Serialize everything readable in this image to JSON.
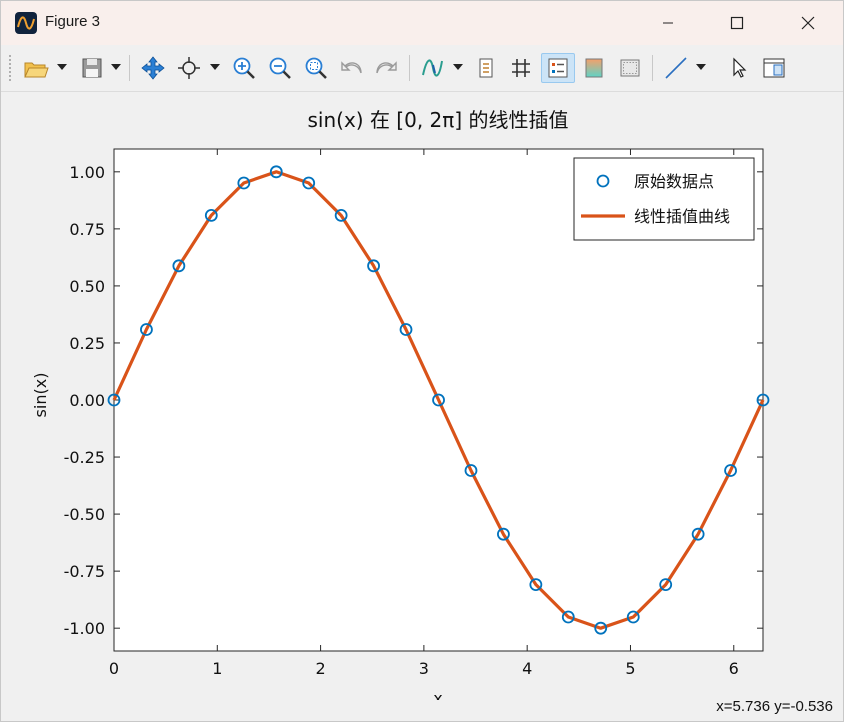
{
  "window": {
    "title": "Figure 3"
  },
  "toolbar": {
    "items": [
      "open-icon",
      "save-icon",
      "pan-icon",
      "data-cursor-icon",
      "zoom-in-icon",
      "zoom-out-icon",
      "zoom-fit-icon",
      "undo-icon",
      "redo-icon",
      "insert-legend-icon",
      "colorbar-icon",
      "grid-icon",
      "legend-toggle-icon",
      "colormap-icon",
      "border-icon",
      "line-style-icon",
      "select-icon",
      "property-inspector-icon"
    ]
  },
  "status": {
    "coords": "x=5.736 y=-0.536"
  },
  "colors": {
    "series_line": "#d95319",
    "markers": "#0072bd"
  },
  "chart_data": {
    "type": "line",
    "title": "sin(x) 在 [0, 2π] 的线性插值",
    "xlabel": "x",
    "ylabel": "sin(x)",
    "xlim": [
      0,
      6.283
    ],
    "ylim": [
      -1.1,
      1.1
    ],
    "xticks": [
      0,
      1,
      2,
      3,
      4,
      5,
      6
    ],
    "xtick_labels": [
      "0",
      "1",
      "2",
      "3",
      "4",
      "5",
      "6"
    ],
    "yticks": [
      -1.0,
      -0.75,
      -0.5,
      -0.25,
      0.0,
      0.25,
      0.5,
      0.75,
      1.0
    ],
    "ytick_labels": [
      "-1.00",
      "-0.75",
      "-0.50",
      "-0.25",
      "0.00",
      "0.25",
      "0.50",
      "0.75",
      "1.00"
    ],
    "legend_position": "top-right",
    "grid": false,
    "series": [
      {
        "name": "原始数据点",
        "kind": "scatter",
        "marker": "circle-open",
        "x": [
          0,
          0.314,
          0.628,
          0.942,
          1.257,
          1.571,
          1.885,
          2.199,
          2.513,
          2.827,
          3.142,
          3.456,
          3.77,
          4.084,
          4.398,
          4.712,
          5.027,
          5.341,
          5.655,
          5.969,
          6.283
        ],
        "y": [
          0,
          0.309,
          0.588,
          0.809,
          0.951,
          1.0,
          0.951,
          0.809,
          0.588,
          0.309,
          0,
          -0.309,
          -0.588,
          -0.809,
          -0.951,
          -1.0,
          -0.951,
          -0.809,
          -0.588,
          -0.309,
          0
        ]
      },
      {
        "name": "线性插值曲线",
        "kind": "line",
        "x": [
          0,
          0.314,
          0.628,
          0.942,
          1.257,
          1.571,
          1.885,
          2.199,
          2.513,
          2.827,
          3.142,
          3.456,
          3.77,
          4.084,
          4.398,
          4.712,
          5.027,
          5.341,
          5.655,
          5.969,
          6.283
        ],
        "y": [
          0,
          0.309,
          0.588,
          0.809,
          0.951,
          1.0,
          0.951,
          0.809,
          0.588,
          0.309,
          0,
          -0.309,
          -0.588,
          -0.809,
          -0.951,
          -1.0,
          -0.951,
          -0.809,
          -0.588,
          -0.309,
          0
        ]
      }
    ]
  }
}
